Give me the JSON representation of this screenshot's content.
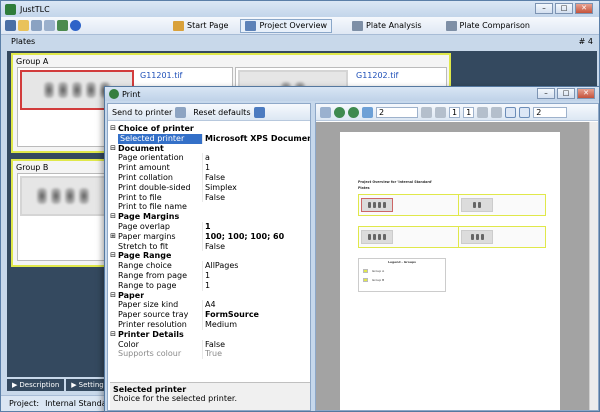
{
  "app": {
    "title": "JustTLC"
  },
  "toolbar": {
    "start_page": "Start Page",
    "project_overview": "Project Overview",
    "plate_analysis": "Plate Analysis",
    "plate_comparison": "Plate Comparison"
  },
  "plates": {
    "label": "Plates",
    "count": "# 4",
    "groups": [
      {
        "name": "Group A",
        "plates": [
          "G11201.tif",
          "G11202.tif"
        ]
      },
      {
        "name": "Group B"
      }
    ]
  },
  "bottom_tabs": [
    "Description",
    "Settings"
  ],
  "status": {
    "project_label": "Project:",
    "project_value": "Internal Standard"
  },
  "print_dialog": {
    "title": "Print",
    "send_to_printer": "Send to printer",
    "reset_defaults": "Reset defaults",
    "categories": [
      {
        "name": "Choice of printer",
        "rows": [
          {
            "name": "Selected printer",
            "value": "Microsoft XPS Documen",
            "selected": true,
            "bold": true,
            "dropdown": true
          }
        ]
      },
      {
        "name": "Document",
        "rows": [
          {
            "name": "Page orientation",
            "value": "a"
          },
          {
            "name": "Print amount",
            "value": "1"
          },
          {
            "name": "Print collation",
            "value": "False"
          },
          {
            "name": "Print double-sided",
            "value": "Simplex"
          },
          {
            "name": "Print to file",
            "value": "False"
          },
          {
            "name": "Print to file name",
            "value": ""
          }
        ]
      },
      {
        "name": "Page Margins",
        "rows": [
          {
            "name": "Page overlap",
            "value": "1",
            "bold": true
          },
          {
            "name": "Paper margins",
            "value": "100; 100; 100; 60",
            "bold": true,
            "expand": true
          },
          {
            "name": "Stretch to fit",
            "value": "False"
          }
        ]
      },
      {
        "name": "Page Range",
        "rows": [
          {
            "name": "Range choice",
            "value": "AllPages"
          },
          {
            "name": "Range from page",
            "value": "1"
          },
          {
            "name": "Range to page",
            "value": "1"
          }
        ]
      },
      {
        "name": "Paper",
        "rows": [
          {
            "name": "Paper size kind",
            "value": "A4"
          },
          {
            "name": "Paper source tray",
            "value": "FormSource",
            "bold": true
          },
          {
            "name": "Printer resolution",
            "value": "Medium"
          }
        ]
      },
      {
        "name": "Printer Details",
        "rows": [
          {
            "name": "Color",
            "value": "False"
          },
          {
            "name": "Supports colour",
            "value": "True",
            "disabled": true
          }
        ]
      }
    ],
    "help": {
      "title": "Selected printer",
      "text": "Choice for the selected printer."
    },
    "preview": {
      "zoom_value": "2",
      "current_page": "1",
      "total_pages": "1",
      "pages_value": "2",
      "page": {
        "title": "Project Overview for 'Internal Standard'",
        "subtitle": "Plates",
        "legend_title": "Legend - Groups",
        "legend_items": [
          "Group A",
          "Group B"
        ]
      }
    }
  }
}
